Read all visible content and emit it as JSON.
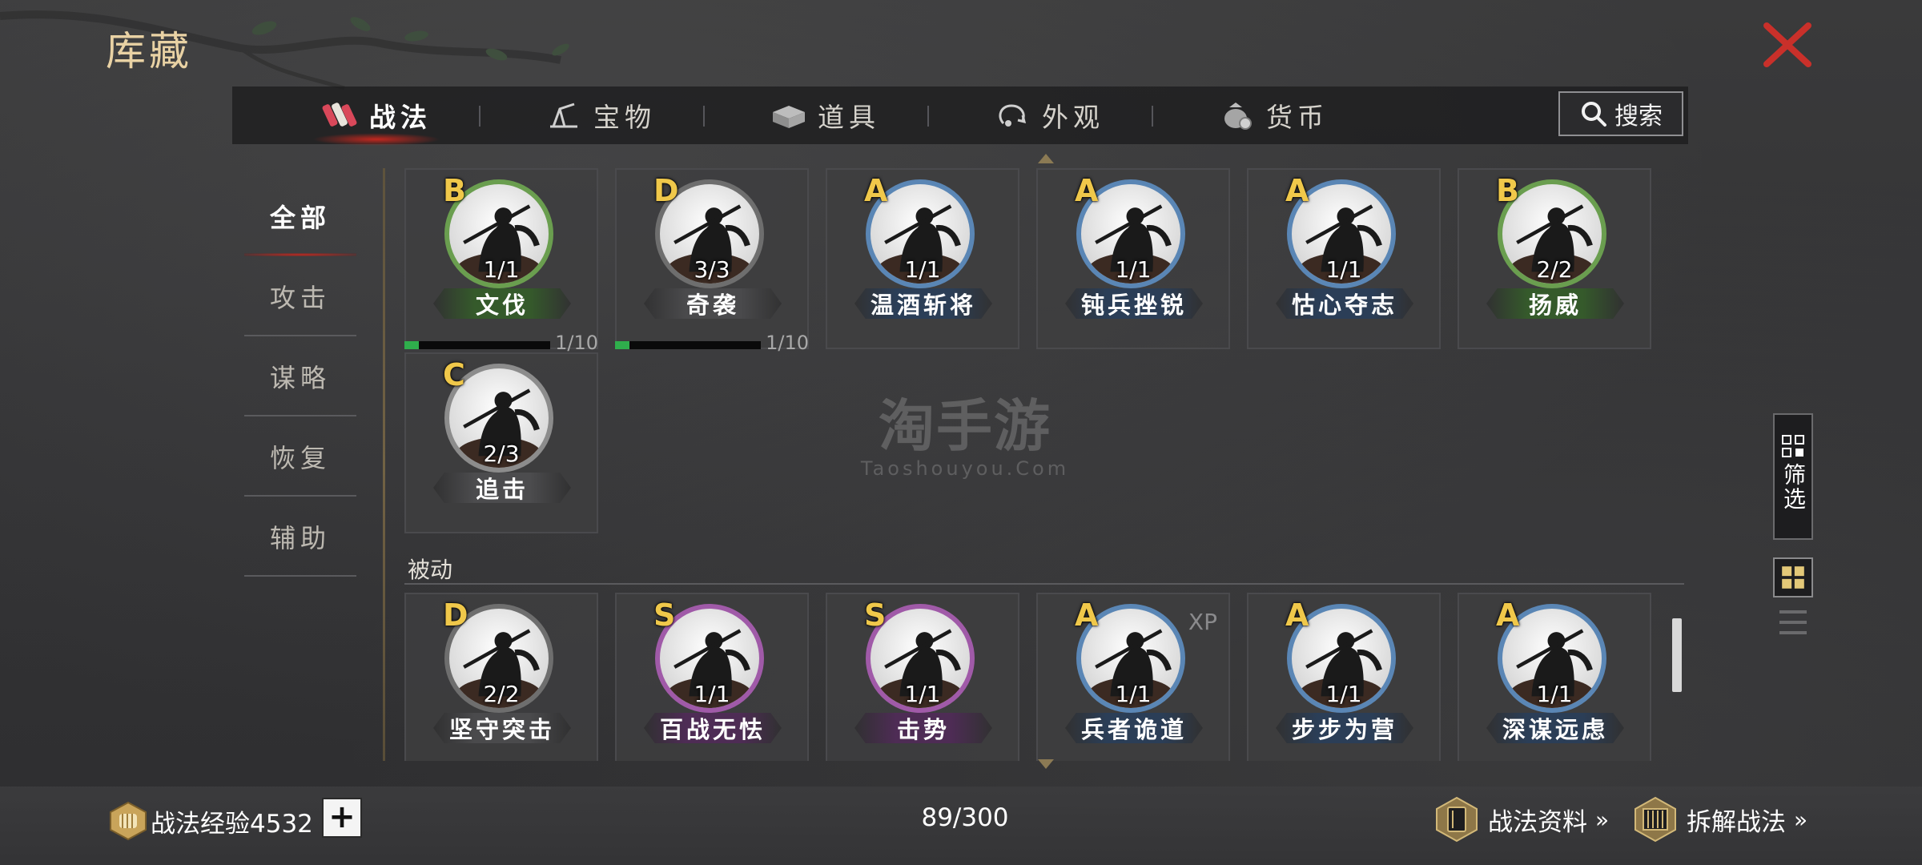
{
  "header": {
    "title": "库藏"
  },
  "tabs": [
    {
      "label": "战法",
      "icon": "scroll-bundle-icon",
      "active": true
    },
    {
      "label": "宝物",
      "icon": "treasure-icon",
      "active": false
    },
    {
      "label": "道具",
      "icon": "item-box-icon",
      "active": false
    },
    {
      "label": "外观",
      "icon": "appearance-icon",
      "active": false
    },
    {
      "label": "货币",
      "icon": "money-bag-icon",
      "active": false
    }
  ],
  "search": {
    "label": "搜索"
  },
  "sidebar": {
    "items": [
      {
        "label": "全部",
        "active": true
      },
      {
        "label": "攻击",
        "active": false
      },
      {
        "label": "谋略",
        "active": false
      },
      {
        "label": "恢复",
        "active": false
      },
      {
        "label": "辅助",
        "active": false
      }
    ]
  },
  "active_cards": [
    {
      "grade": "B",
      "count": "1/1",
      "name": "文伐",
      "ring": "#6a9e4f",
      "banner": "#355a2b",
      "progress": {
        "label": "1/10",
        "fraction": 0.1
      }
    },
    {
      "grade": "D",
      "count": "3/3",
      "name": "奇袭",
      "ring": "#6e6e6e",
      "banner": "#4a4a4c",
      "progress": {
        "label": "1/10",
        "fraction": 0.1
      }
    },
    {
      "grade": "A",
      "count": "1/1",
      "name": "温酒斩将",
      "ring": "#5a86b5",
      "banner": "#2b3e57"
    },
    {
      "grade": "A",
      "count": "1/1",
      "name": "钝兵挫锐",
      "ring": "#5a86b5",
      "banner": "#2b3e57"
    },
    {
      "grade": "A",
      "count": "1/1",
      "name": "怙心夺志",
      "ring": "#5a86b5",
      "banner": "#2b3e57"
    },
    {
      "grade": "B",
      "count": "2/2",
      "name": "扬威",
      "ring": "#6a9e4f",
      "banner": "#355a2b"
    },
    {
      "grade": "C",
      "count": "2/3",
      "name": "追击",
      "ring": "#8c8c8c",
      "banner": "#4c4c4e"
    }
  ],
  "passive_section": {
    "label": "被动"
  },
  "passive_cards": [
    {
      "grade": "D",
      "count": "2/2",
      "name": "坚守突击",
      "ring": "#6e6e6e",
      "banner": "#4a4a4c"
    },
    {
      "grade": "S",
      "count": "1/1",
      "name": "百战无怯",
      "ring": "#a05aa8",
      "banner": "#4e2c55"
    },
    {
      "grade": "S",
      "count": "1/1",
      "name": "击势",
      "ring": "#a05aa8",
      "banner": "#4e2c55"
    },
    {
      "grade": "A",
      "count": "1/1",
      "name": "兵者诡道",
      "ring": "#5a86b5",
      "banner": "#2b3e57",
      "badge": "XP"
    },
    {
      "grade": "A",
      "count": "1/1",
      "name": "步步为营",
      "ring": "#5a86b5",
      "banner": "#2b3e57"
    },
    {
      "grade": "A",
      "count": "1/1",
      "name": "深谋远虑",
      "ring": "#5a86b5",
      "banner": "#2b3e57"
    }
  ],
  "filter": {
    "label": "筛选"
  },
  "watermark": {
    "line1": "淘手游",
    "line2": "Taoshouyou.Com"
  },
  "footer": {
    "exp_label": "战法经验4532",
    "plus": "+",
    "capacity": "89/300",
    "info_link": "战法资料",
    "dismantle_link": "拆解战法",
    "chevron": "»"
  },
  "colors": {
    "grade_text": "#f0c84a",
    "accent_red": "#c8281e",
    "title_gold": "#e9d2a4"
  }
}
